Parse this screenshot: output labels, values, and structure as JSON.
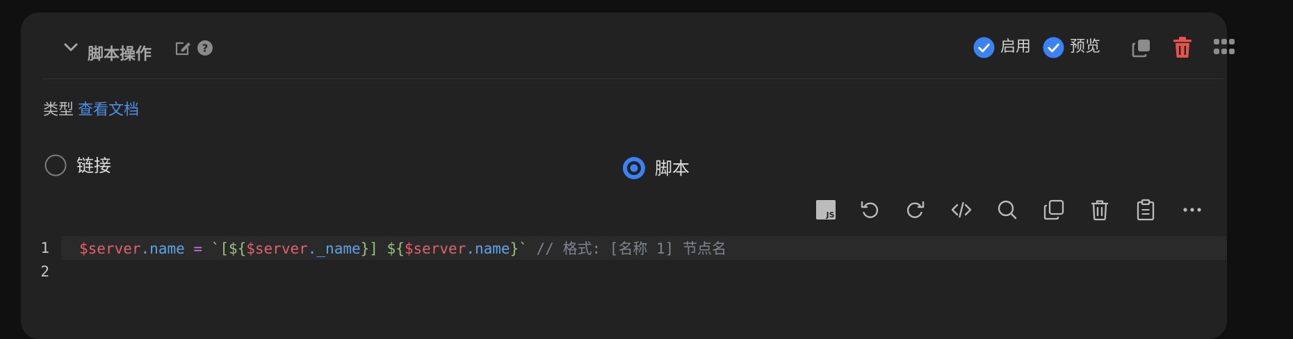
{
  "header": {
    "title": "脚本操作",
    "enable_label": "启用",
    "preview_label": "预览"
  },
  "type_section": {
    "label": "类型",
    "doc_link": "查看文档",
    "options": [
      {
        "label": "链接",
        "selected": false
      },
      {
        "label": "脚本",
        "selected": true
      }
    ]
  },
  "toolbar": {
    "icons": [
      "js-icon",
      "undo-icon",
      "redo-icon",
      "code-format-icon",
      "search-icon",
      "copy-icon",
      "delete-icon",
      "paste-icon",
      "more-icon"
    ]
  },
  "editor": {
    "line_numbers": [
      "1",
      "2"
    ],
    "line1": {
      "var1": "$server",
      "prop1": ".name",
      "assign": " = ",
      "str_open": "`[${",
      "var2": "$server",
      "prop2": "._name",
      "str_mid": "}] ${",
      "var3": "$server",
      "prop3": ".name",
      "str_close": "}`",
      "comment": " // 格式: [名称 1] 节点名"
    }
  },
  "colors": {
    "accent": "#3b82f6",
    "danger": "#e5534b",
    "link": "#4d8fe6",
    "background": "#222223"
  }
}
